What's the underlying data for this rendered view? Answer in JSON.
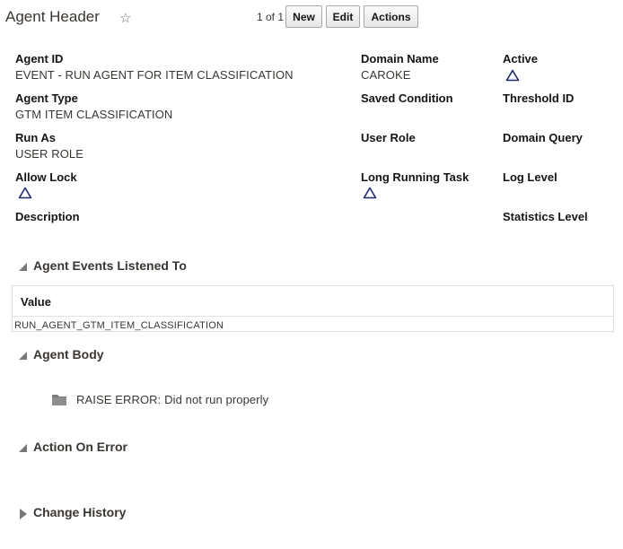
{
  "header": {
    "title": "Agent Header",
    "star_icon": "☆",
    "counter": "1 of 1",
    "buttons": {
      "new": "New",
      "edit": "Edit",
      "actions": "Actions"
    }
  },
  "fields": {
    "agent_id": {
      "label": "Agent ID",
      "value": "EVENT - RUN AGENT FOR ITEM CLASSIFICATION"
    },
    "domain_name": {
      "label": "Domain Name",
      "value": "CAROKE"
    },
    "active": {
      "label": "Active",
      "icon": "triangle-indicator-icon"
    },
    "agent_type": {
      "label": "Agent Type",
      "value": "GTM ITEM CLASSIFICATION"
    },
    "saved_condition": {
      "label": "Saved Condition"
    },
    "threshold_id": {
      "label": "Threshold ID"
    },
    "run_as": {
      "label": "Run As",
      "value": "USER ROLE"
    },
    "user_role": {
      "label": "User Role"
    },
    "domain_query": {
      "label": "Domain Query"
    },
    "allow_lock": {
      "label": "Allow Lock",
      "icon": "triangle-indicator-icon"
    },
    "long_running_task": {
      "label": "Long Running Task",
      "icon": "triangle-indicator-icon"
    },
    "log_level": {
      "label": "Log Level"
    },
    "description": {
      "label": "Description"
    },
    "statistics_level": {
      "label": "Statistics Level"
    }
  },
  "sections": {
    "events": {
      "title": "Agent Events Listened To",
      "column": "Value",
      "rows": [
        "RUN_AGENT_GTM_ITEM_CLASSIFICATION"
      ]
    },
    "body": {
      "title": "Agent Body",
      "item": "RAISE ERROR: Did not run properly",
      "item_icon": "folder-icon"
    },
    "action_on_error": {
      "title": "Action On Error"
    },
    "change_history": {
      "title": "Change History"
    }
  },
  "colors": {
    "indicator": "#1f2a6b",
    "text": "#161513"
  }
}
